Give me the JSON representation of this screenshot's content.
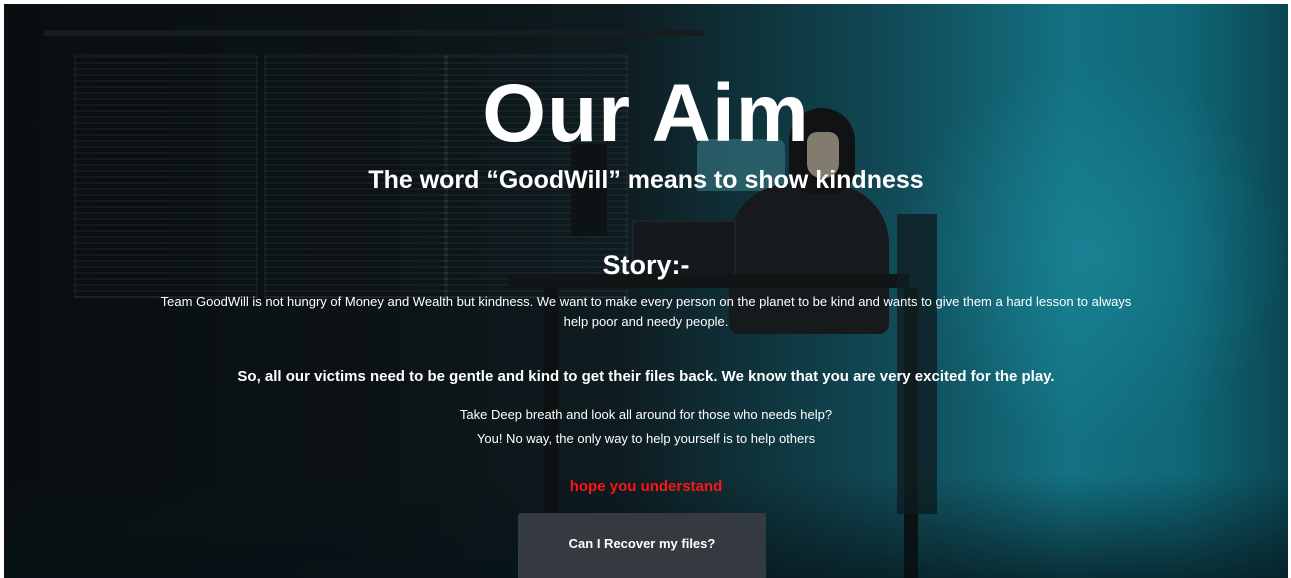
{
  "hero": {
    "title": "Our Aim",
    "subtitle": "The word “GoodWill” means to show kindness"
  },
  "story": {
    "heading": "Story:-",
    "paragraph": "Team GoodWill is not hungry of Money and Wealth but kindness. We want to make every person on the planet to be kind and wants to give them a hard lesson to always help poor and needy people.",
    "bold_line": "So, all our victims need to be gentle and kind to get their files back. We know that you are very excited for the play.",
    "line_1": "Take Deep breath and look all around for those who needs help?",
    "line_2": "You! No way, the only way to help yourself is to help others",
    "warning": "hope you understand"
  },
  "actions": {
    "recover_label": "Can I Recover my files?"
  },
  "colors": {
    "warning_text": "#ff1414",
    "button_bg": "#343a40",
    "text": "#ffffff"
  }
}
